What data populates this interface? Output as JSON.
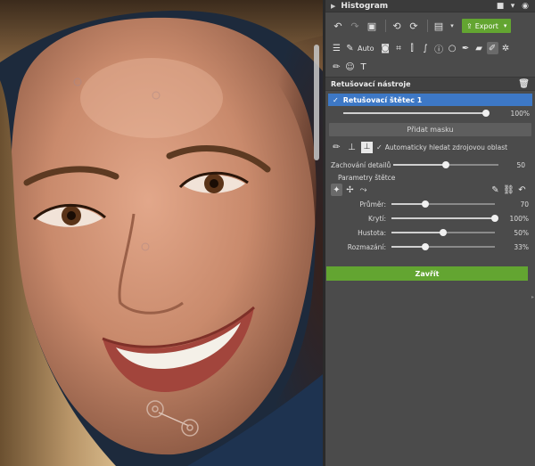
{
  "panel": {
    "histogram_title": "Histogram",
    "export_label": "Export",
    "auto_label": "Auto",
    "section_title": "Retušovací nástroje",
    "layer": {
      "name": "Retušovací štětec 1",
      "opacity": "100%",
      "opacity_value": 100
    },
    "add_mask_label": "Přidat masku",
    "auto_source_label": "Automaticky hledat zdrojovou oblast",
    "detail": {
      "label": "Zachování detailů",
      "value": "50",
      "fraction": 0.5
    },
    "brush_params_title": "Parametry štětce",
    "brush": [
      {
        "label": "Průměr:",
        "value": "70",
        "fraction": 0.33
      },
      {
        "label": "Krytí:",
        "value": "100%",
        "fraction": 1.0
      },
      {
        "label": "Hustota:",
        "value": "50%",
        "fraction": 0.5
      },
      {
        "label": "Rozmazání:",
        "value": "33%",
        "fraction": 0.33
      }
    ],
    "close_label": "Zavřít"
  },
  "colors": {
    "accent_green": "#63a531",
    "selection_blue": "#3d78c6",
    "panel_bg": "#4b4b4b"
  },
  "icons": [
    "undo-icon",
    "redo-icon",
    "image-icon",
    "rotate-left-icon",
    "rotate-right-icon",
    "save-icon",
    "export-icon",
    "gear-icon",
    "camera-icon",
    "dropper-icon",
    "crop-icon",
    "brush-icon",
    "stamp-icon",
    "trash-icon",
    "link-icon"
  ]
}
